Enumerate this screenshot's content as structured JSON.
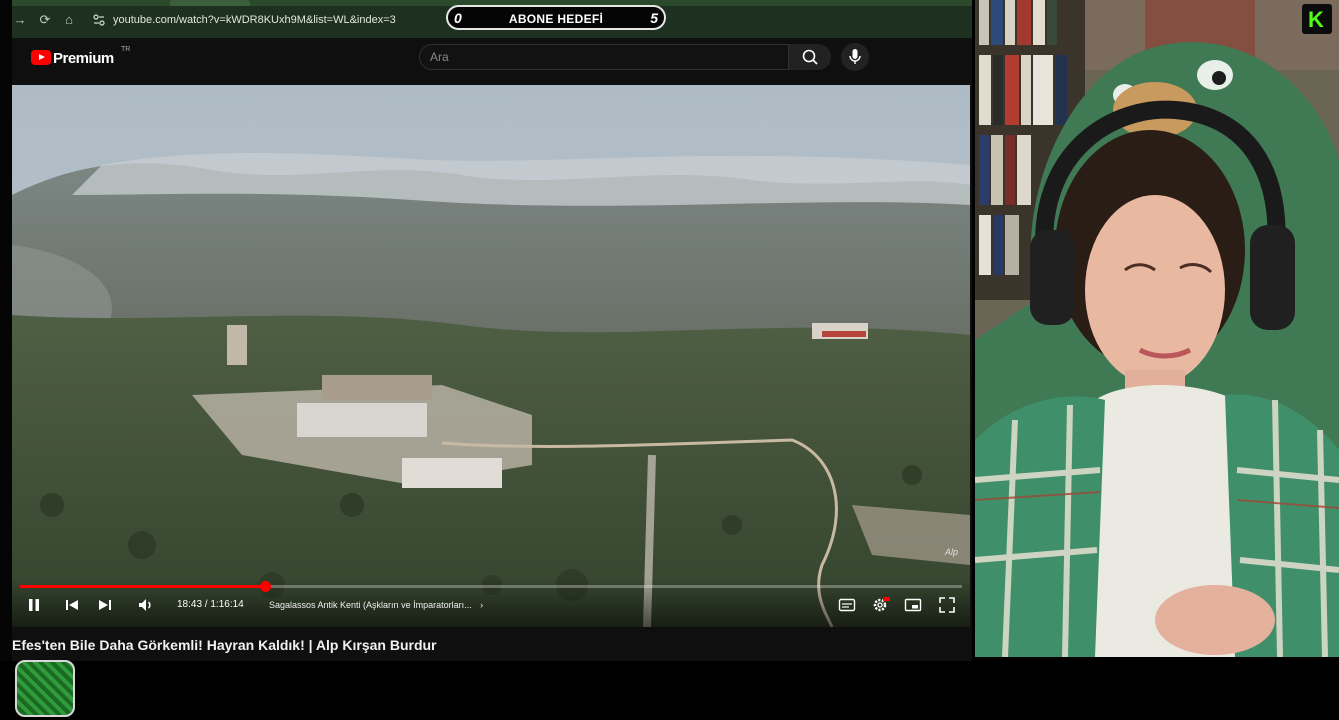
{
  "browser": {
    "url": "youtube.com/watch?v=kWDR8KUxh9M&list=WL&index=3"
  },
  "goal_overlay": {
    "left_value": "0",
    "label": "ABONE HEDEFİ",
    "right_value": "5"
  },
  "youtube": {
    "logo_text": "Premium",
    "region": "TR",
    "search_placeholder": "Ara"
  },
  "player": {
    "progress": 0.26,
    "time_label": "18:43 / 1:16:14",
    "chapter": "Sagalassos Antik Kenti (Aşkların ve İmparatorları...",
    "watermark": "Alp",
    "title": "Efes'ten Bile Daha Görkemli! Hayran Kaldık! | Alp Kırşan Burdur"
  },
  "colors": {
    "youtube_red": "#ff0000",
    "kick_green": "#53fc18",
    "browser_chrome": "#1e3020"
  },
  "kick_logo_letter": "K"
}
